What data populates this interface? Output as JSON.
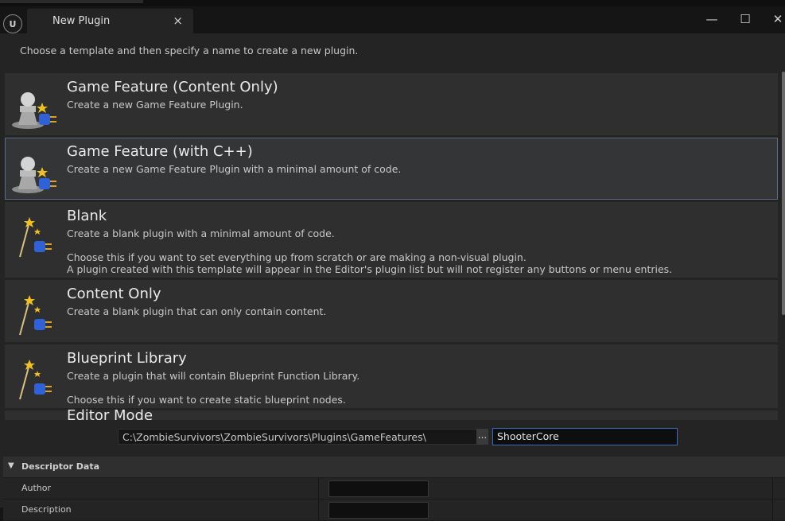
{
  "window": {
    "tab_title": "New Plugin",
    "tab_close": "×",
    "minimize": "—",
    "maximize": "☐",
    "close": "✕"
  },
  "intro_text": "Choose a template and then specify a name to create a new plugin.",
  "templates": [
    {
      "title": "Game Feature (Content Only)",
      "desc": [
        "Create a new Game Feature Plugin."
      ],
      "icon": "game-feature-pawn-icon",
      "selected": false
    },
    {
      "title": "Game Feature (with C++)",
      "desc": [
        "Create a new Game Feature Plugin with a minimal amount of code."
      ],
      "icon": "game-feature-pawn-icon",
      "selected": true
    },
    {
      "title": "Blank",
      "desc": [
        "Create a blank plugin with a minimal amount of code.",
        "",
        "Choose this if you want to set everything up from scratch or are making a non-visual plugin.",
        "A plugin created with this template will appear in the Editor's plugin list but will not register any buttons or menu entries."
      ],
      "icon": "magic-wand-plug-icon",
      "selected": false
    },
    {
      "title": "Content Only",
      "desc": [
        "Create a blank plugin that can only contain content."
      ],
      "icon": "magic-wand-plug-icon",
      "selected": false
    },
    {
      "title": "Blueprint Library",
      "desc": [
        "Create a plugin that will contain Blueprint Function Library.",
        "",
        "Choose this if you want to create static blueprint nodes."
      ],
      "icon": "magic-wand-plug-icon",
      "selected": false
    },
    {
      "title": "Editor Mode",
      "desc": [],
      "icon": "magic-wand-plug-icon",
      "selected": false
    }
  ],
  "path": {
    "value": "C:\\ZombieSurvivors\\ZombieSurvivors\\Plugins\\GameFeatures\\",
    "browse_label": "..."
  },
  "plugin_name": "ShooterCore",
  "descriptor": {
    "section_title": "Descriptor Data",
    "rows": [
      {
        "label": "Author"
      },
      {
        "label": "Description"
      }
    ]
  },
  "colors": {
    "accent": "#3c6db8",
    "selected_border": "#5d6d84",
    "panel": "#2f2f2f",
    "background": "#242424"
  }
}
